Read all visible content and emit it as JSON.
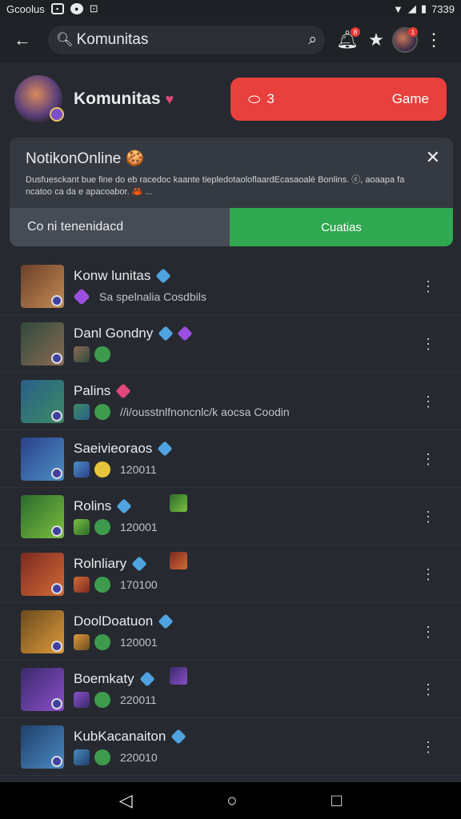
{
  "statusbar": {
    "carrier": "Gcoolus",
    "time": "7339"
  },
  "appbar": {
    "search_text": "Komunitas",
    "notif_badge": "8",
    "avatar_badge": "1"
  },
  "community": {
    "title": "Komunitas",
    "game_count": "3",
    "game_label": "Game"
  },
  "notice": {
    "title": "NotikonOnline",
    "emoji": "🍪",
    "desc": "Dusfuesckant bue fine do eb racedoc kaante tiepledotaoloflaardEcasaoalé Bonlins. ⓒ, aoaapa fa ncatoo ca da e apacoabor. 🦀 ...",
    "tab_left": "Co ni tenenidacd",
    "tab_right": "Cuatias"
  },
  "accent": {
    "red": "#e8403d",
    "green": "#2fa851",
    "verify": "#4fa3e0"
  },
  "list": [
    {
      "name": "Konw lunitas",
      "sub": "Sa spelnalia Cosdbils",
      "sub_icon": "purple-spark-icon",
      "colors": [
        "#6b3f2b",
        "#c58b52"
      ]
    },
    {
      "name": "Danl Gondny",
      "sub": "",
      "sub_icon": "purple-dice-icon",
      "colors": [
        "#2f4a3d",
        "#8a6a52"
      ]
    },
    {
      "name": "Palins",
      "sub": "//i/ousstnlfnoncnlc/k aocsa Coodin",
      "sub_icon": "heart-icon",
      "colors": [
        "#2a5f8a",
        "#3b8b63"
      ]
    },
    {
      "name": "Saeivieoraos",
      "sub": "120011",
      "sub_icon": "",
      "colors": [
        "#2c3f8a",
        "#4b8fc3"
      ]
    },
    {
      "name": "Rolins",
      "sub": "120001",
      "sub_icon": "",
      "colors": [
        "#2b6a2f",
        "#7bbf3c"
      ]
    },
    {
      "name": "Rolnliary",
      "sub": "170100",
      "sub_icon": "",
      "colors": [
        "#7a2a1f",
        "#d46a38"
      ]
    },
    {
      "name": "DoolDoatuon",
      "sub": "120001",
      "sub_icon": "",
      "colors": [
        "#6a4a1f",
        "#e09a3a"
      ]
    },
    {
      "name": "Boemkaty",
      "sub": "220011",
      "sub_icon": "",
      "colors": [
        "#3a2a6a",
        "#8a4fc9"
      ]
    },
    {
      "name": "KubKacanaiton",
      "sub": "220010",
      "sub_icon": "",
      "colors": [
        "#1f3f6a",
        "#4a8ac3"
      ]
    }
  ],
  "nav": {
    "back": "◁",
    "home": "○",
    "recents": "□"
  }
}
